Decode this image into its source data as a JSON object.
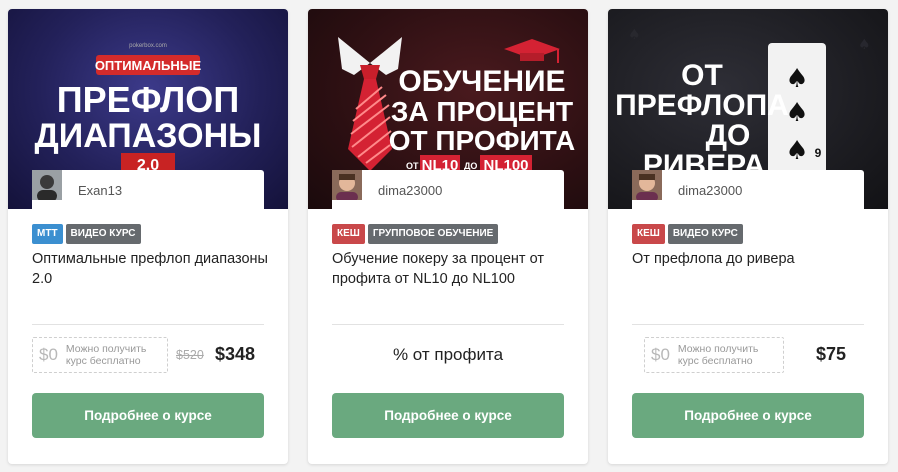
{
  "cards": [
    {
      "banner": {
        "site": "pokerbox.com",
        "ribbon": "ОПТИМАЛЬНЫЕ",
        "line1": "ПРЕФЛОП",
        "line2": "ДИАПАЗОНЫ",
        "badge": "2.0"
      },
      "author": "Exan13",
      "tags": [
        {
          "label": "MTT",
          "color": "#3b8fd0"
        },
        {
          "label": "ВИДЕО КУРС",
          "color": "#666a6e"
        }
      ],
      "title": "Оптимальные префлоп диапазоны 2.0",
      "free_price": "$0",
      "free_text": "Можно получить курс бесплатно",
      "old_price": "$520",
      "price": "$348",
      "button": "Подробнее о курсе"
    },
    {
      "banner": {
        "line1": "ОБУЧЕНИЕ",
        "line2": "ЗА ПРОЦЕНТ",
        "line3": "ОТ ПРОФИТА",
        "from": "ОТ",
        "nl_low": "NL10",
        "to": "ДО",
        "nl_high": "NL100"
      },
      "author": "dima23000",
      "tags": [
        {
          "label": "КЕШ",
          "color": "#c9484a"
        },
        {
          "label": "ГРУППОВОЕ ОБУЧЕНИЕ",
          "color": "#666a6e"
        }
      ],
      "title": "Обучение покеру за процент от профита от NL10 до NL100",
      "price_text": "% от профита",
      "button": "Подробнее о курсе"
    },
    {
      "banner": {
        "line1": "ОТ",
        "line2": "ПРЕФЛОПА",
        "line3": "ДО",
        "line4": "РИВЕРА",
        "card_rank": "9"
      },
      "author": "dima23000",
      "tags": [
        {
          "label": "КЕШ",
          "color": "#c9484a"
        },
        {
          "label": "ВИДЕО КУРС",
          "color": "#666a6e"
        }
      ],
      "title": "От префлопа до ривера",
      "free_price": "$0",
      "free_text": "Можно получить курс бесплатно",
      "price": "$75",
      "button": "Подробнее о курсе"
    }
  ],
  "colors": {
    "button": "#6aa97f",
    "tag_blue": "#3b8fd0",
    "tag_red": "#c9484a",
    "tag_gray": "#666a6e"
  }
}
